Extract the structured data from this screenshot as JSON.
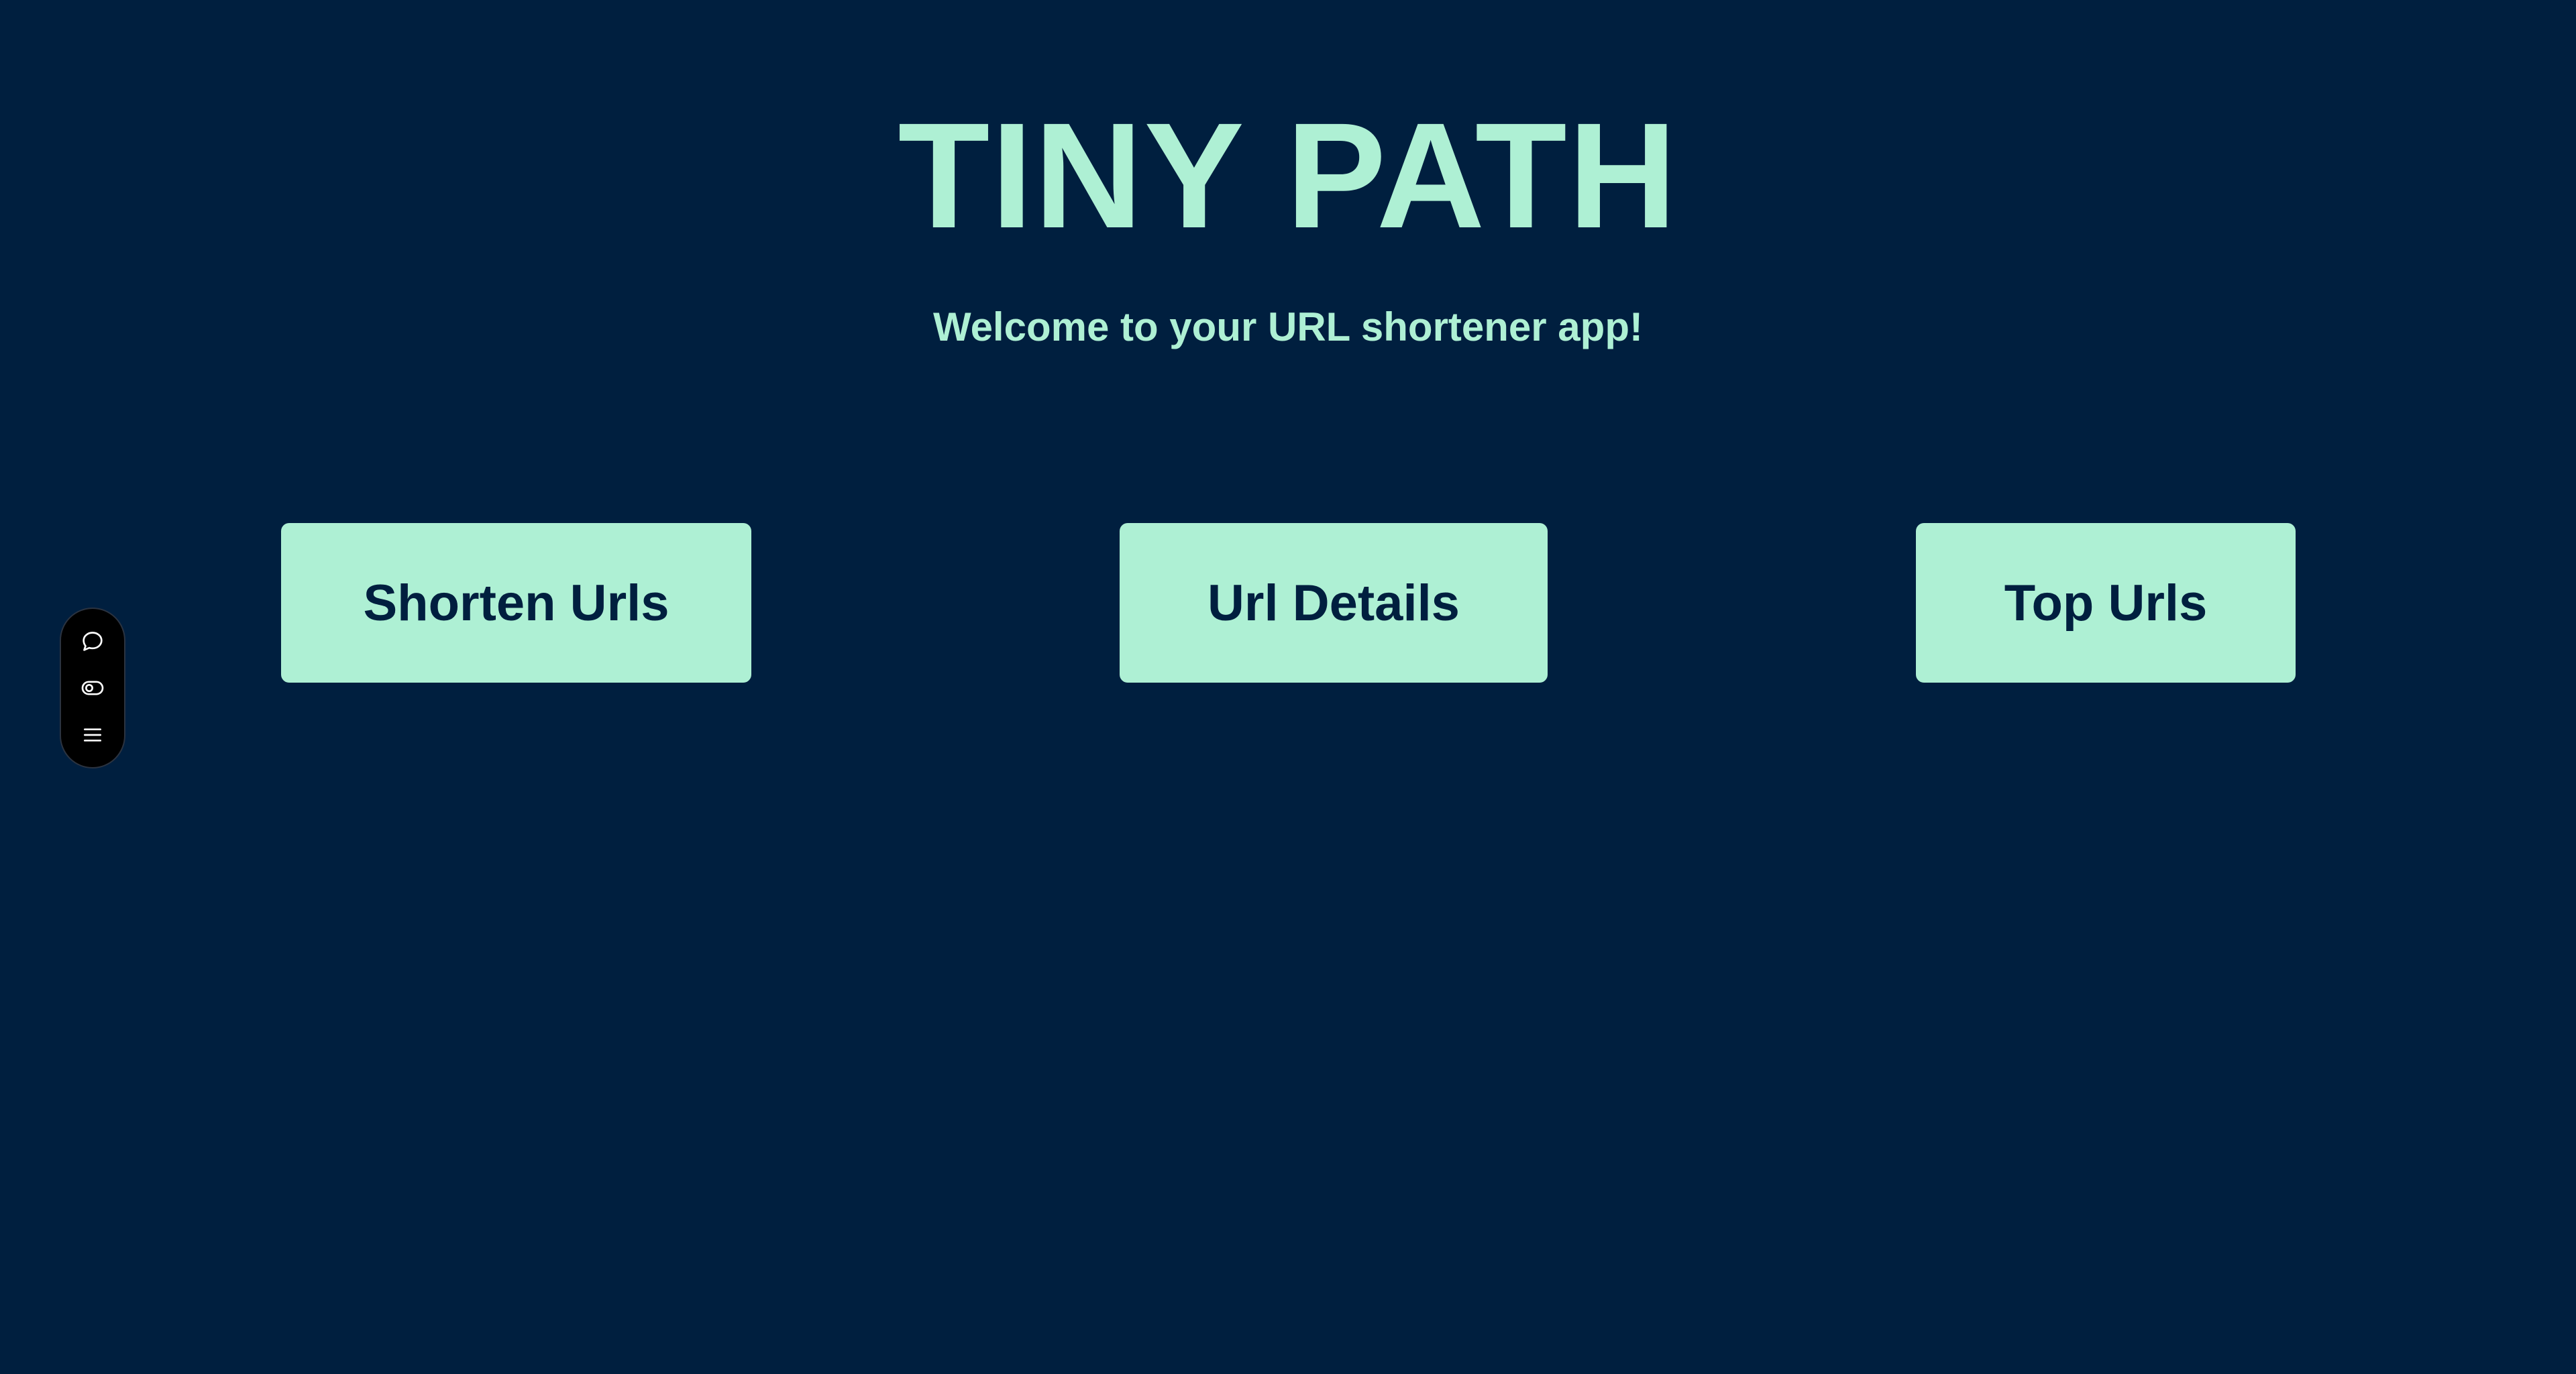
{
  "app": {
    "title": "TINY PATH",
    "subtitle": "Welcome to your URL shortener app!"
  },
  "nav": {
    "buttons": [
      {
        "label": "Shorten Urls",
        "icon": ""
      },
      {
        "label": "Url Details",
        "icon": ""
      },
      {
        "label": "Top Urls",
        "icon": ""
      }
    ]
  },
  "toolbar": {
    "icons": [
      "chat-bubble-icon",
      "toggle-icon",
      "menu-icon"
    ]
  },
  "colors": {
    "background": "#001f3f",
    "accent": "#aef0d4",
    "toolbar_bg": "#000000"
  }
}
